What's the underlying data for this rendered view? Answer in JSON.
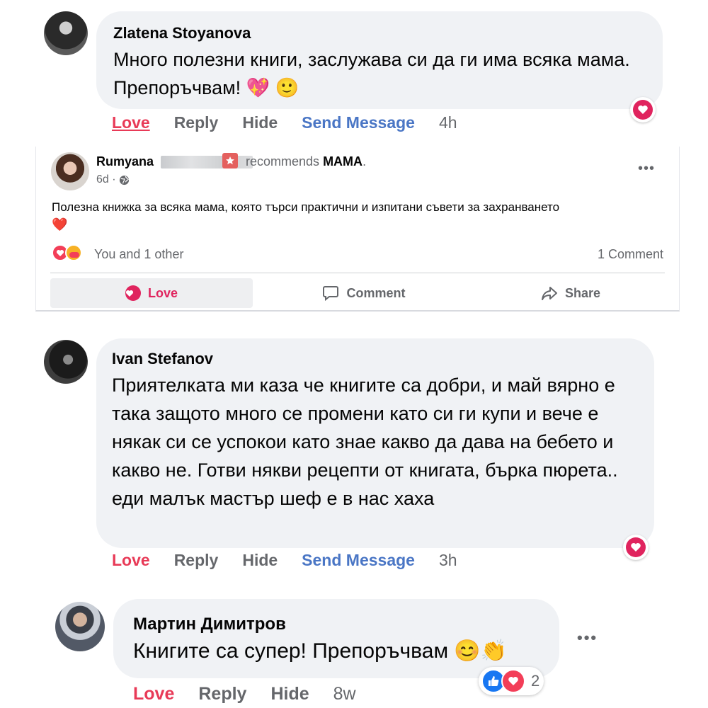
{
  "comments": [
    {
      "author": "Zlatena Stoyanova",
      "text": "Много полезни книги, заслужава си да ги има всяка мама. Препоръчвам! 💖 🙂",
      "actions": {
        "love": "Love",
        "reply": "Reply",
        "hide": "Hide",
        "send_message": "Send Message",
        "time": "4h"
      }
    },
    {
      "author": "Ivan Stefanov",
      "text": "Приятелката ми каза че книгите са добри, и май вярно е така защото много се промени като си ги купи и вече е някак си се успокои като знае какво да дава на бебето и какво не. Готви някви рецепти от книгата, бърка пюрета.. еди малък мастър шеф е в нас хаха",
      "actions": {
        "love": "Love",
        "reply": "Reply",
        "hide": "Hide",
        "send_message": "Send Message",
        "time": "3h"
      }
    },
    {
      "author": "Мартин Димитров",
      "text": "Книгите са супер! Препоръчвам 😊👏",
      "actions": {
        "love": "Love",
        "reply": "Reply",
        "hide": "Hide",
        "time": "8w"
      },
      "reaction_count": "2"
    }
  ],
  "post": {
    "author": "Rumyana",
    "recommends_prefix": "recommends",
    "page_name": "MAMA",
    "recommends_suffix": ".",
    "time": "6d ·",
    "text": "Полезна книжка за всяка мама, която търси практични и изпитани съвети за захранването",
    "text_emoji": "❤️",
    "reactions_text": "You and 1 other",
    "comments_count": "1 Comment",
    "buttons": {
      "love": "Love",
      "comment": "Comment",
      "share": "Share"
    },
    "more": "•••"
  },
  "colors": {
    "love_accent": "#e83a57",
    "send_message": "#4a76c5",
    "bubble_bg": "#f0f2f5",
    "muted": "#65676b"
  },
  "icons": [
    "heart-icon",
    "globe-icon",
    "comment-icon",
    "share-icon",
    "like-icon",
    "more-icon",
    "recommend-icon"
  ]
}
